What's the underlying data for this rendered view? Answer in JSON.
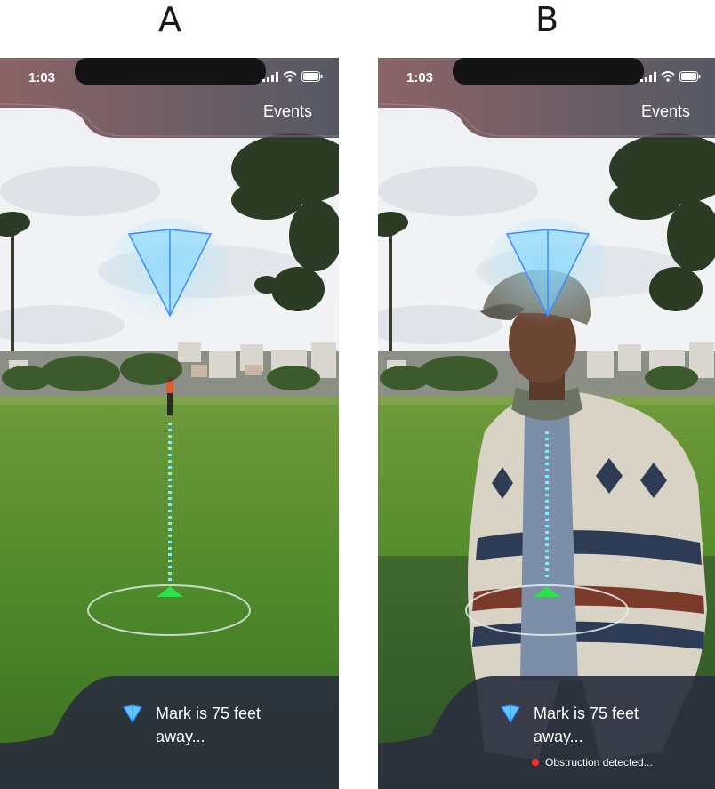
{
  "panels": [
    {
      "letter": "A",
      "status_time": "1:03",
      "nav_link": "Events",
      "message": "Mark is 75 feet away...",
      "obstruction": null
    },
    {
      "letter": "B",
      "status_time": "1:03",
      "nav_link": "Events",
      "message": "Mark is 75 feet away...",
      "obstruction": "Obstruction detected..."
    }
  ],
  "icons": {
    "signal": "cellular-signal-icon",
    "wifi": "wifi-icon",
    "battery": "battery-icon",
    "marker": "location-marker-icon",
    "arrow": "direction-arrow-icon",
    "alert": "red-status-dot-icon"
  },
  "colors": {
    "marker_fill": "#7fd6ff",
    "marker_stroke": "#3a8cff",
    "path_dash": "#7af0ff",
    "arrow": "#2ee04a",
    "obstruction_dot": "#ff2d2d",
    "overlay": "#2a2f3d"
  }
}
